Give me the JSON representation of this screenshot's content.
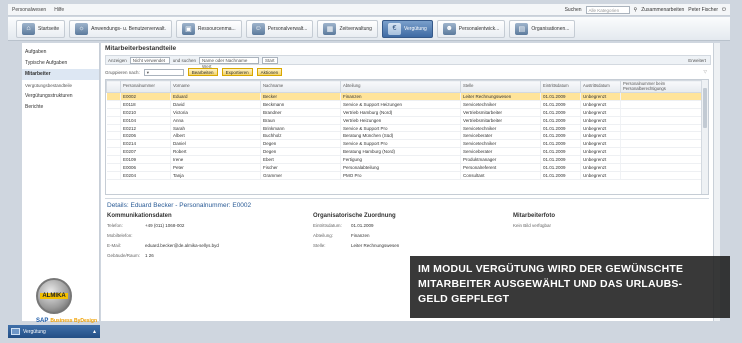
{
  "menubar": {
    "items": [
      "Personalwesen",
      "Hilfe"
    ],
    "search_label": "Suchen",
    "search_placeholder": "Alle Kategorien",
    "right": [
      "Zusammenarbeiten",
      "Peter Fischer"
    ]
  },
  "toolbar": {
    "items": [
      {
        "label": "Startseite",
        "icon": "home-icon"
      },
      {
        "label": "Anwendungs- u. Benutzerverwalt.",
        "icon": "user-gear-icon"
      },
      {
        "label": "Ressourcenma...",
        "icon": "resource-icon"
      },
      {
        "label": "Personalverwalt...",
        "icon": "people-icon"
      },
      {
        "label": "Zeitverwaltung",
        "icon": "calendar-icon"
      },
      {
        "label": "Vergütung",
        "icon": "payroll-icon",
        "active": true
      },
      {
        "label": "Personalentwick...",
        "icon": "development-icon"
      },
      {
        "label": "Organisationen...",
        "icon": "org-icon"
      }
    ]
  },
  "nav": {
    "items": [
      {
        "label": "Aufgaben",
        "sel": false
      },
      {
        "label": "Typische Aufgaben",
        "sel": false
      },
      {
        "label": "Mitarbeiter",
        "sel": true
      },
      {
        "label": "Vergütungsbestandteile",
        "sel": false,
        "sub": true
      },
      {
        "label": "Vergütungsstrukturen",
        "sel": false
      },
      {
        "label": "Berichte",
        "sel": false
      }
    ]
  },
  "main": {
    "title": "Mitarbeiterbestandteile",
    "filter": {
      "show": "Anzeigen",
      "show_value": "Nicht verwendet",
      "search_label": "und suchen",
      "search_value": "Name oder Nachname Wert",
      "start": "Start",
      "reset": "Erweitert"
    },
    "group": {
      "label": "Gruppieren nach:",
      "edit": "Bearbeiten",
      "export": "Exportieren",
      "actions": "Aktionen"
    },
    "columns": [
      "Personalnummer",
      "Vorname",
      "Nachname",
      "Abteilung",
      "Stelle",
      "Eintrittsdatum",
      "Austrittsdatum",
      "Personalnummer beim Personalberechtigungs"
    ],
    "rows": [
      [
        "E0002",
        "Eduard",
        "Becker",
        "Finanzen",
        "Leiter Rechnungswesen",
        "01.01.2009",
        "Unbegrenzt",
        ""
      ],
      [
        "E0118",
        "David",
        "Beckmann",
        "Service & Support Heizungen",
        "Servicetechniker",
        "01.01.2009",
        "Unbegrenzt",
        ""
      ],
      [
        "E0210",
        "Victoria",
        "Brandner",
        "Vertrieb Hamburg (Nord)",
        "Vertriebsmitarbeiter",
        "01.01.2009",
        "Unbegrenzt",
        ""
      ],
      [
        "E0104",
        "Anna",
        "Braun",
        "Vertrieb Heizungen",
        "Vertriebsmitarbeiter",
        "01.01.2009",
        "Unbegrenzt",
        ""
      ],
      [
        "E0212",
        "Sarah",
        "Brinkmann",
        "Service & Support Pro",
        "Servicetechniker",
        "01.01.2009",
        "Unbegrenzt",
        ""
      ],
      [
        "E0206",
        "Albert",
        "Buchholz",
        "Beratung München (Süd)",
        "Serviceberater",
        "01.01.2009",
        "Unbegrenzt",
        ""
      ],
      [
        "E0214",
        "Daniel",
        "Degen",
        "Service & Support Pro",
        "Servicetechniker",
        "01.01.2009",
        "Unbegrenzt",
        ""
      ],
      [
        "E0207",
        "Robert",
        "Degen",
        "Beratung Hamburg (Nord)",
        "Serviceberater",
        "01.01.2009",
        "Unbegrenzt",
        ""
      ],
      [
        "E0109",
        "Irene",
        "Ebert",
        "Fertigung",
        "Produktmanager",
        "01.01.2009",
        "Unbegrenzt",
        ""
      ],
      [
        "E0006",
        "Peter",
        "Fischer",
        "Personalabteilung",
        "Personalreferent",
        "01.01.2009",
        "Unbegrenzt",
        ""
      ],
      [
        "E0204",
        "Tanja",
        "Grammer",
        "PMO Pro",
        "Consultant",
        "01.01.2009",
        "Unbegrenzt",
        ""
      ]
    ],
    "details": {
      "title": "Details: Eduard Becker - Personalnummer: E0002",
      "kommunikation": {
        "heading": "Kommunikationsdaten",
        "rows": [
          [
            "Telefon:",
            "+49 (011) 1068-002"
          ],
          [
            "Mobiltelefon:",
            ""
          ],
          [
            "E-Mail:",
            "eduard.becker@de.almika-sellys.byd"
          ],
          [
            "Gebäude/Raum:",
            "1 26"
          ]
        ]
      },
      "org": {
        "heading": "Organisatorische Zuordnung",
        "rows": [
          [
            "Eintrittsdatum:",
            "01.01.2009"
          ],
          [
            "Abteilung:",
            "Finanzen"
          ],
          [
            "Stelle:",
            "Leiter Rechnungswesen"
          ]
        ]
      },
      "foto": {
        "heading": "Mitarbeiterfoto",
        "text": "Kein Bild verfügbar"
      }
    }
  },
  "overlay": {
    "lines": [
      "IM MODUL VERGÜTUNG WIRD DER GEWÜNSCHTE",
      "MITARBEITER AUSGEWÄHLT UND DAS URLAUBS-",
      "GELD GEPFLEGT"
    ]
  },
  "logo": {
    "text": "ALMIKA",
    "sap": "SAP",
    "sap_sub": "Business ByDesign"
  },
  "taskbar": {
    "label": "Vergütung"
  }
}
